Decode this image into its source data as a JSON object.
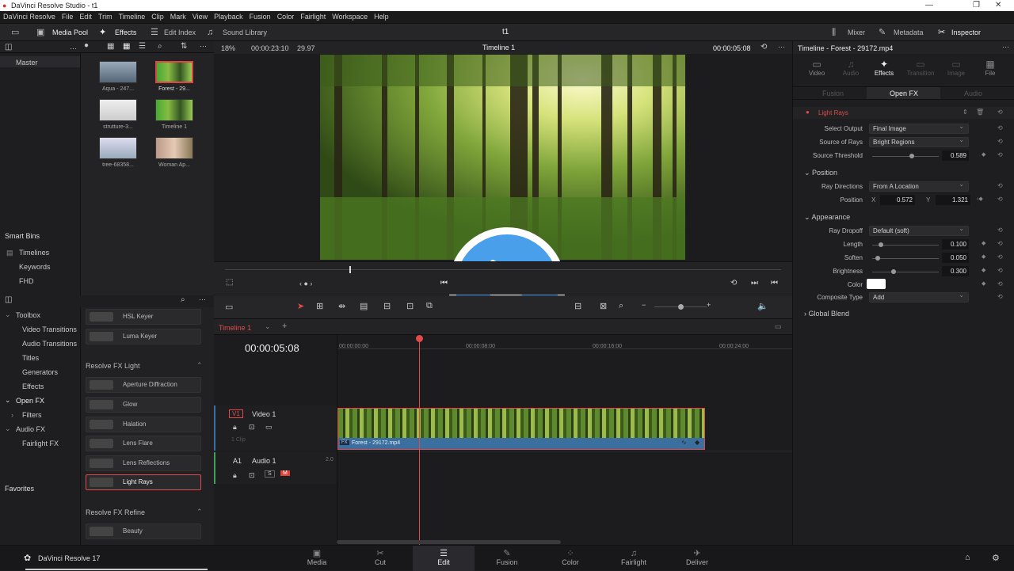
{
  "window": {
    "title": "DaVinci Resolve Studio - t1"
  },
  "menu": [
    "DaVinci Resolve",
    "File",
    "Edit",
    "Trim",
    "Timeline",
    "Clip",
    "Mark",
    "View",
    "Playback",
    "Fusion",
    "Color",
    "Fairlight",
    "Workspace",
    "Help"
  ],
  "toolbar": {
    "media_pool": "Media Pool",
    "effects": "Effects",
    "edit_index": "Edit Index",
    "sound_library": "Sound Library",
    "project_name": "t1",
    "mixer": "Mixer",
    "metadata": "Metadata",
    "inspector": "Inspector"
  },
  "media_bar": {
    "zoom": "18%",
    "timecode": "00:00:23:10",
    "fps": "29.97",
    "timeline_name": "Timeline 1",
    "viewer_tc": "00:00:05:08"
  },
  "bins": {
    "master": "Master",
    "smart_bins": "Smart Bins",
    "items": [
      "Timelines",
      "Keywords",
      "FHD"
    ]
  },
  "clips": [
    "Aqua - 247...",
    "Forest - 29...",
    "strutture-3...",
    "Timeline 1",
    "tree-68358...",
    "Woman Ap..."
  ],
  "fx_tree": {
    "items": [
      "Toolbox",
      "Video Transitions",
      "Audio Transitions",
      "Titles",
      "Generators",
      "Effects",
      "Open FX",
      "Filters",
      "Audio FX",
      "Fairlight FX"
    ],
    "favorites": "Favorites"
  },
  "fx_list": {
    "top": [
      "HSL Keyer",
      "Luma Keyer"
    ],
    "sec1": "Resolve FX Light",
    "light": [
      "Aperture Diffraction",
      "Glow",
      "Halation",
      "Lens Flare",
      "Lens Reflections",
      "Light Rays"
    ],
    "sec2": "Resolve FX Refine",
    "refine": [
      "Beauty"
    ]
  },
  "timeline": {
    "tab": "Timeline 1",
    "tc": "00:00:05:08",
    "ruler": [
      "00:00:00:00",
      "00:00:08:00",
      "00:00:16:00",
      "00:00:24:00"
    ],
    "v1_tag": "V1",
    "v1": "Video 1",
    "v1_sub": "1 Clip",
    "a1_tag": "A1",
    "a1": "Audio 1",
    "a1_ch": "2.0",
    "clip": "Forest - 29172.mp4",
    "s": "S",
    "m": "M"
  },
  "inspector": {
    "title": "Timeline - Forest - 29172.mp4",
    "tabs": [
      "Video",
      "Audio",
      "Effects",
      "Transition",
      "Image",
      "File"
    ],
    "subtabs": [
      "Fusion",
      "Open FX",
      "Audio"
    ],
    "effect": "Light Rays",
    "select_output_l": "Select Output",
    "select_output": "Final Image",
    "source_rays_l": "Source of Rays",
    "source_rays": "Bright Regions",
    "threshold_l": "Source Threshold",
    "threshold": "0.589",
    "threshold_level": 0.589,
    "position_sec": "Position",
    "ray_dir_l": "Ray Directions",
    "ray_dir": "From A Location",
    "pos_l": "Position",
    "x_l": "X",
    "x": "0.572",
    "y_l": "Y",
    "y": "1.321",
    "appearance_sec": "Appearance",
    "dropoff_l": "Ray Dropoff",
    "dropoff": "Default (soft)",
    "length_l": "Length",
    "length": "0.100",
    "length_level": 0.1,
    "soften_l": "Soften",
    "soften": "0.050",
    "soften_level": 0.05,
    "bright_l": "Brightness",
    "bright": "0.300",
    "bright_level": 0.3,
    "color_l": "Color",
    "color": "#ffffff",
    "comp_l": "Composite Type",
    "comp": "Add",
    "global": "Global Blend"
  },
  "pages": [
    "Media",
    "Cut",
    "Edit",
    "Fusion",
    "Color",
    "Fairlight",
    "Deliver"
  ],
  "app_name": "DaVinci Resolve 17",
  "colors": {
    "accent": "#e04a4a",
    "play": "#4a9fea"
  }
}
